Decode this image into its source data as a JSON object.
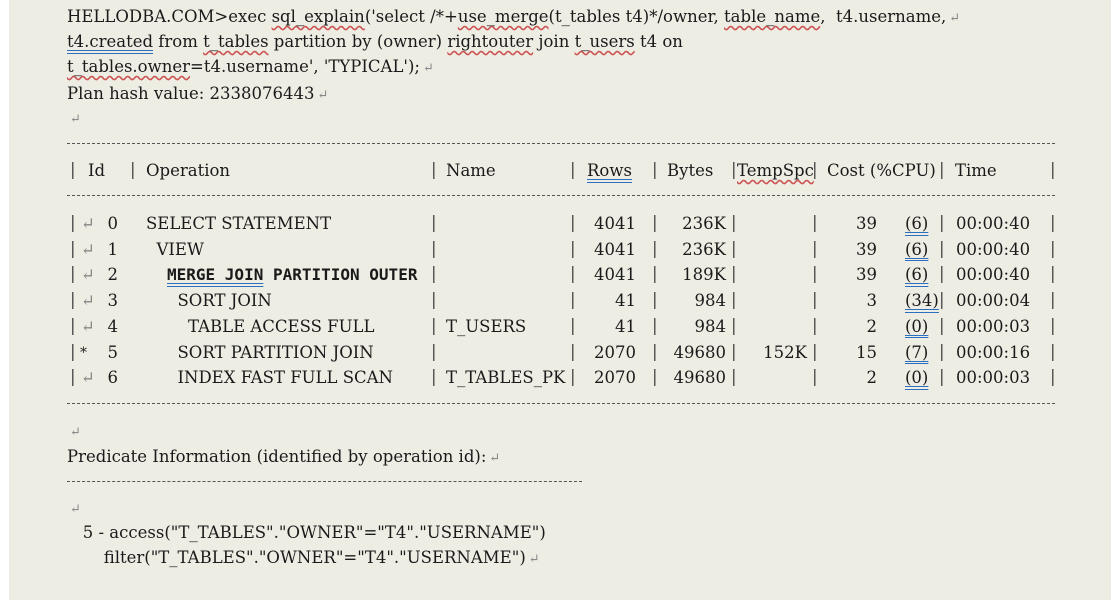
{
  "query": {
    "line1_prefix": "HELLODBA.COM>exec ",
    "line1_func": "sql_explain",
    "line1_mid": "('select /*+",
    "line1_hint": "use_merge",
    "line1_hint2": "(t_tables t4)*/owner, ",
    "line1_col": "table_name",
    "line1_rest": ",  t4.username,",
    "line2_a": "t4.created",
    "line2_b": " from ",
    "line2_c": "t_tables",
    "line2_d": " partition by (owner) ",
    "line2_e": "rightouter",
    "line2_f": " join ",
    "line2_g": "t_users",
    "line2_h": " t4 on",
    "line3_a": "t_tables.owner",
    "line3_b": "=t4.username', 'TYPICAL');",
    "plan_hash": "Plan hash value: 2338076443"
  },
  "plan_table": {
    "headers": {
      "id": "Id",
      "operation": "Operation",
      "name": "Name",
      "rows": "Rows",
      "bytes": "Bytes",
      "tempspc": "TempSpc",
      "cost": "Cost (%CPU)",
      "time": "Time"
    },
    "rows": [
      {
        "marker": "",
        "id": "0",
        "operation": "SELECT STATEMENT",
        "name": "",
        "rows": "4041",
        "bytes": "236K",
        "tempspc": "",
        "cost": "39",
        "cpu": "(6)",
        "time": "00:00:40"
      },
      {
        "marker": "",
        "id": "1",
        "operation": "VIEW",
        "name": "",
        "rows": "4041",
        "bytes": "236K",
        "tempspc": "",
        "cost": "39",
        "cpu": "(6)",
        "time": "00:00:40"
      },
      {
        "marker": "",
        "id": "2",
        "operation": "MERGE JOIN PARTITION OUTER",
        "name": "",
        "rows": "4041",
        "bytes": "189K",
        "tempspc": "",
        "cost": "39",
        "cpu": "(6)",
        "time": "00:00:40"
      },
      {
        "marker": "",
        "id": "3",
        "operation": "SORT JOIN",
        "name": "",
        "rows": "41",
        "bytes": "984",
        "tempspc": "",
        "cost": "3",
        "cpu": "(34)",
        "time": "00:00:04"
      },
      {
        "marker": "",
        "id": "4",
        "operation": "TABLE ACCESS FULL",
        "name": "T_USERS",
        "rows": "41",
        "bytes": "984",
        "tempspc": "",
        "cost": "2",
        "cpu": "(0)",
        "time": "00:00:03"
      },
      {
        "marker": "*",
        "id": "5",
        "operation": "SORT PARTITION JOIN",
        "name": "",
        "rows": "2070",
        "bytes": "49680",
        "tempspc": "152K",
        "cost": "15",
        "cpu": "(7)",
        "time": "00:00:16"
      },
      {
        "marker": "",
        "id": "6",
        "operation": "INDEX FAST FULL SCAN",
        "name": "T_TABLES_PK",
        "rows": "2070",
        "bytes": "49680",
        "tempspc": "",
        "cost": "2",
        "cpu": "(0)",
        "time": "00:00:03"
      }
    ]
  },
  "predicate": {
    "title": "Predicate Information (identified by operation id):",
    "line1": "   5 - access(\"T_TABLES\".\"OWNER\"=\"T4\".\"USERNAME\")",
    "line2": "       filter(\"T_TABLES\".\"OWNER\"=\"T4\".\"USERNAME\")"
  },
  "icons": {
    "paragraph_mark": "return-arrow-icon",
    "tab_mark": "tab-marker-icon"
  },
  "colors": {
    "page_background": "#eeede4",
    "spell_underline": "#c55",
    "grammar_underline": "#2a6fc2"
  }
}
